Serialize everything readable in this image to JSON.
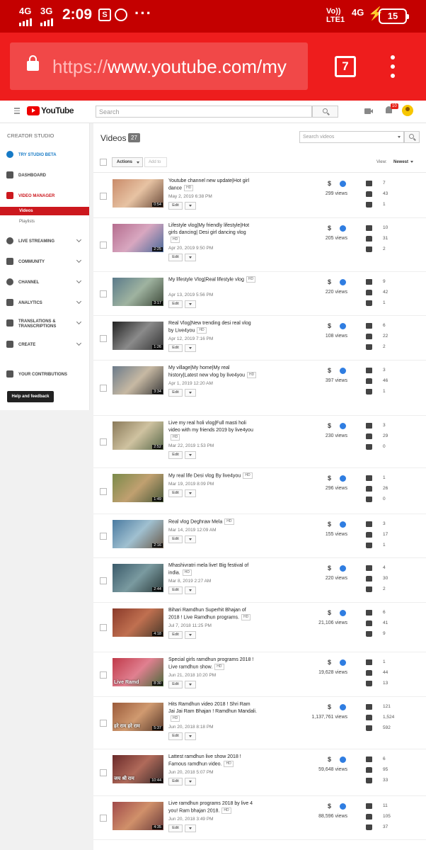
{
  "status_bar": {
    "net1": "4G",
    "net2": "3G",
    "time": "2:09",
    "s_icon": "S",
    "more": "···",
    "volte": "Vo))",
    "lte": "LTE1",
    "net3": "4G",
    "battery": "15"
  },
  "browser": {
    "url_proto": "https://",
    "url_rest": "www.youtube.com/my",
    "tab_count": "7"
  },
  "youtube_header": {
    "logo_text": "YouTube",
    "search_placeholder": "Search",
    "notification_count": "10"
  },
  "sidebar": {
    "title": "CREATOR STUDIO",
    "items": [
      {
        "label": "TRY STUDIO BETA",
        "icon": "gear-icon"
      },
      {
        "label": "DASHBOARD",
        "icon": "dashboard-icon"
      },
      {
        "label": "VIDEO MANAGER",
        "icon": "video-manager-icon"
      },
      {
        "label": "LIVE STREAMING",
        "icon": "live-icon"
      },
      {
        "label": "COMMUNITY",
        "icon": "community-icon"
      },
      {
        "label": "CHANNEL",
        "icon": "channel-icon"
      },
      {
        "label": "ANALYTICS",
        "icon": "analytics-icon"
      },
      {
        "label": "TRANSLATIONS & TRANSCRIPTIONS",
        "icon": "translate-icon"
      },
      {
        "label": "CREATE",
        "icon": "create-icon"
      },
      {
        "label": "YOUR CONTRIBUTIONS",
        "icon": "contributions-icon"
      }
    ],
    "sub_videos": "Videos",
    "sub_playlists": "Playlists",
    "help_button": "Help and feedback"
  },
  "main": {
    "title": "Videos",
    "count": "27",
    "search_placeholder": "Search videos",
    "actions_label": "Actions",
    "add_to_label": "Add to",
    "view_label": "View:",
    "sort_label": "Newest"
  },
  "common": {
    "hd": "HD",
    "edit": "Edit"
  },
  "videos": [
    {
      "title": "Youtube channel new update|Hot girl dance",
      "date": "May 2, 2019 6:38 PM",
      "duration": "0:54",
      "views": "299 views",
      "comments": "7",
      "likes": "43",
      "dislikes": "1",
      "overlay": ""
    },
    {
      "title": "Lifestyle vlog|My friendly lifestyle|Hot girls dancing| Desi girl dancing vlog",
      "date": "Apr 20, 2019 9:50 PM",
      "duration": "2:25",
      "views": "205 views",
      "comments": "10",
      "likes": "31",
      "dislikes": "2",
      "overlay": ""
    },
    {
      "title": "My lifestyle Vlog|Real lifestyle vlog",
      "date": "Apr 13, 2019 5:56 PM",
      "duration": "3:17",
      "views": "220 views",
      "comments": "9",
      "likes": "42",
      "dislikes": "1",
      "overlay": ""
    },
    {
      "title": "Real Vlog|New trending desi real vlog by Live4you",
      "date": "Apr 12, 2019 7:16 PM",
      "duration": "1:26",
      "views": "108 views",
      "comments": "6",
      "likes": "22",
      "dislikes": "2",
      "overlay": ""
    },
    {
      "title": "My village|My home|My real history|Latest new vlog by live4you",
      "date": "Apr 1, 2019 12:20 AM",
      "duration": "3:34",
      "views": "397 views",
      "comments": "3",
      "likes": "46",
      "dislikes": "1",
      "overlay": ""
    },
    {
      "title": "Live my real holi vlog|Full masti holi video with my friends 2019 by live4you",
      "date": "Mar 22, 2019 1:53 PM",
      "duration": "2:52",
      "views": "230 views",
      "comments": "3",
      "likes": "29",
      "dislikes": "0",
      "overlay": ""
    },
    {
      "title": "My real life Desi vlog By live4you",
      "date": "Mar 19, 2019 8:09 PM",
      "duration": "1:49",
      "views": "296 views",
      "comments": "1",
      "likes": "26",
      "dislikes": "0",
      "overlay": ""
    },
    {
      "title": "Real vlog Deghraw Mela",
      "date": "Mar 14, 2019 12:09 AM",
      "duration": "2:16",
      "views": "155 views",
      "comments": "3",
      "likes": "17",
      "dislikes": "1",
      "overlay": ""
    },
    {
      "title": "Mhashivratri mela live! Big festival of india.",
      "date": "Mar 8, 2019 2:27 AM",
      "duration": "2:44",
      "views": "220 views",
      "comments": "4",
      "likes": "30",
      "dislikes": "2",
      "overlay": ""
    },
    {
      "title": "Bihari Ramdhun Superhit Bhajan of 2018 ! Live Ramdhun programs.",
      "date": "Jul 7, 2018 11:25 PM",
      "duration": "4:18",
      "views": "21,106 views",
      "comments": "6",
      "likes": "41",
      "dislikes": "9",
      "overlay": ""
    },
    {
      "title": "Special girls ramdhun programs 2018 ! Live ramdhun show.",
      "date": "Jun 21, 2018 10:20 PM",
      "duration": "8:30",
      "views": "19,628 views",
      "comments": "1",
      "likes": "44",
      "dislikes": "13",
      "overlay": "Live Ramd"
    },
    {
      "title": "Hits Ramdhun video 2018 ! Shri Ram Jai Jai Ram Bhajan ! Ramdhun Mandali.",
      "date": "Jun 20, 2018 8:18 PM",
      "duration": "5:37",
      "views": "1,137,761 views",
      "comments": "121",
      "likes": "1,524",
      "dislikes": "592",
      "overlay": "हरे राम हरे राम"
    },
    {
      "title": "Lattest ramdhun live show 2018 ! Famous ramdhun video.",
      "date": "Jun 20, 2018 5:07 PM",
      "duration": "10:44",
      "views": "59,648 views",
      "comments": "6",
      "likes": "95",
      "dislikes": "33",
      "overlay": "जय श्री राम"
    },
    {
      "title": "Live ramdhun programs 2018 by live 4 you! Ram bhajan 2018.",
      "date": "Jun 20, 2018 3:49 PM",
      "duration": "4:35",
      "views": "88,596 views",
      "comments": "11",
      "likes": "105",
      "dislikes": "37",
      "overlay": ""
    }
  ],
  "colors": {
    "status_bar": "#c40000",
    "browser_bar": "#ee1d1d",
    "accent_red": "#cc181e",
    "accent_blue": "#167ac6"
  }
}
